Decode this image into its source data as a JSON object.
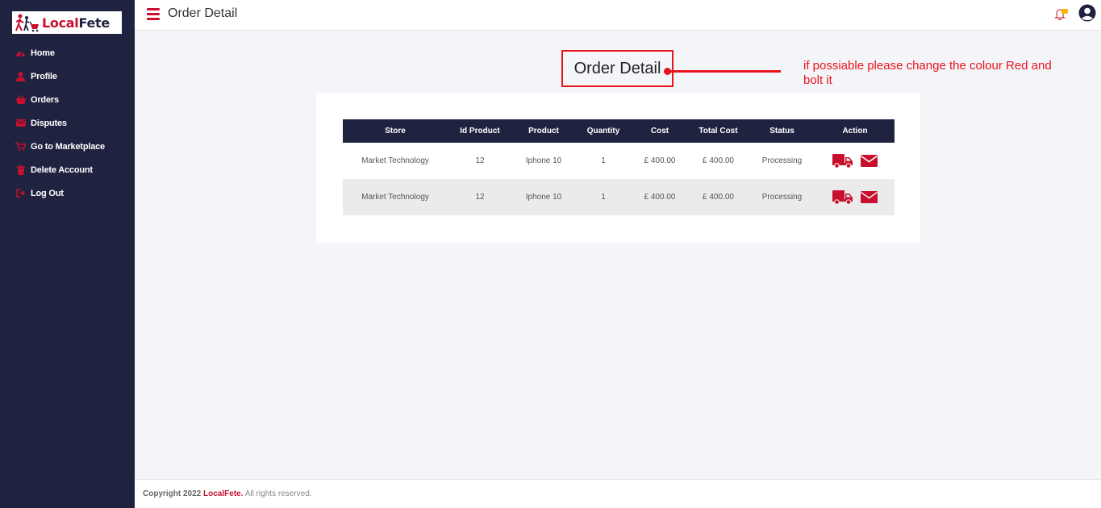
{
  "app": {
    "logo_text_1": "Local",
    "logo_text_2": "Fete"
  },
  "sidebar": {
    "items": [
      {
        "label": "Home",
        "icon": "dashboard-icon"
      },
      {
        "label": "Profile",
        "icon": "user-icon"
      },
      {
        "label": "Orders",
        "icon": "basket-icon"
      },
      {
        "label": "Disputes",
        "icon": "envelope-icon"
      },
      {
        "label": "Go to Marketplace",
        "icon": "cart-icon"
      },
      {
        "label": "Delete Account",
        "icon": "trash-icon"
      },
      {
        "label": "Log Out",
        "icon": "sign-out-icon"
      }
    ]
  },
  "topbar": {
    "title": "Order Detail"
  },
  "annotation": {
    "boxed_title": "Order Detail",
    "note": "if possiable please change the colour Red and bolt it"
  },
  "table": {
    "headers": [
      "Store",
      "Id Product",
      "Product",
      "Quantity",
      "Cost",
      "Total Cost",
      "Status",
      "Action"
    ],
    "rows": [
      {
        "store": "Market Technology",
        "id_product": "12",
        "product": "Iphone 10",
        "quantity": "1",
        "cost": "£ 400.00",
        "total_cost": "£ 400.00",
        "status": "Processing"
      },
      {
        "store": "Market Technology",
        "id_product": "12",
        "product": "Iphone 10",
        "quantity": "1",
        "cost": "£ 400.00",
        "total_cost": "£ 400.00",
        "status": "Processing"
      }
    ]
  },
  "footer": {
    "prefix": "Copyright 2022",
    "brand": "LocalFete.",
    "suffix": "All rights reserved."
  },
  "colors": {
    "accent": "#c8102e",
    "sidebar_bg": "#1f2340",
    "annotation": "#e8141c",
    "page_bg": "#f4f5f9"
  }
}
